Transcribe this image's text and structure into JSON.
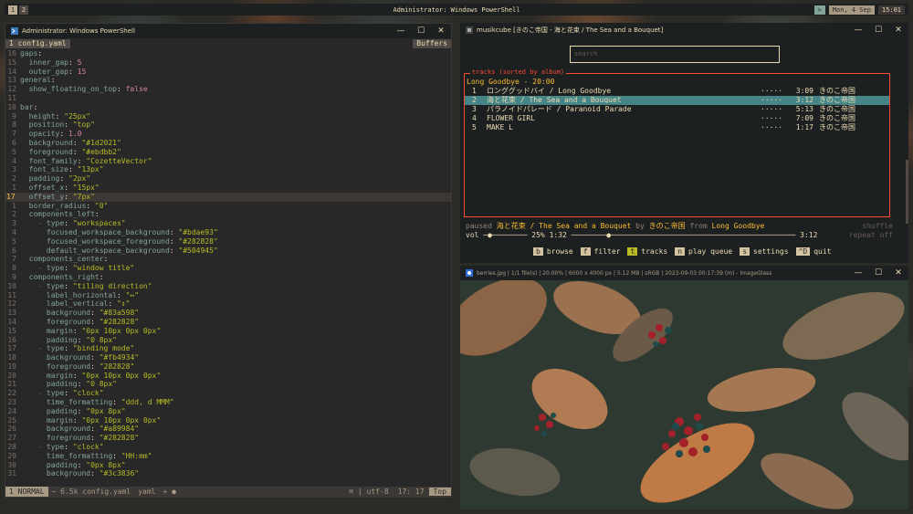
{
  "topbar": {
    "workspaces": [
      "1",
      "2"
    ],
    "window_title": "Administrator: Windows PowerShell",
    "tiling_direction": ">",
    "date": "Mon, 4 Sep",
    "time": "15:01"
  },
  "powershell": {
    "title": "Administrator: Windows PowerShell",
    "tab_file": "1 config.yaml",
    "tab_buffers": "Buffers",
    "lines": [
      {
        "n": "16",
        "t": "gaps:"
      },
      {
        "n": "15",
        "t": "  inner_gap: 5"
      },
      {
        "n": "14",
        "t": "  outer_gap: 15"
      },
      {
        "n": "13",
        "t": "general:"
      },
      {
        "n": "12",
        "t": "  show_floating_on_top: false"
      },
      {
        "n": "11",
        "t": ""
      },
      {
        "n": "10",
        "t": "bar:"
      },
      {
        "n": "9",
        "t": "  height: \"25px\""
      },
      {
        "n": "8",
        "t": "  position: \"top\""
      },
      {
        "n": "7",
        "t": "  opacity: 1.0"
      },
      {
        "n": "6",
        "t": "  background: \"#1d2021\""
      },
      {
        "n": "5",
        "t": "  foreground: \"#ebdbb2\""
      },
      {
        "n": "4",
        "t": "  font_family: \"CozetteVector\""
      },
      {
        "n": "3",
        "t": "  font_size: \"13px\""
      },
      {
        "n": "2",
        "t": "  padding: \"2px\""
      },
      {
        "n": "1",
        "t": "  offset_x: \"15px\""
      },
      {
        "n": "17",
        "t": "  offset_y: \"7px\""
      },
      {
        "n": "1",
        "t": "  border_radius: \"0\""
      },
      {
        "n": "2",
        "t": "  components_left:"
      },
      {
        "n": "3",
        "t": "    - type: \"workspaces\""
      },
      {
        "n": "4",
        "t": "      focused_workspace_background: \"#bdae93\""
      },
      {
        "n": "5",
        "t": "      focused_workspace_foreground: \"#282828\""
      },
      {
        "n": "6",
        "t": "      default_workspace_background: \"#504945\""
      },
      {
        "n": "7",
        "t": "  components_center:"
      },
      {
        "n": "8",
        "t": "    - type: \"window title\""
      },
      {
        "n": "9",
        "t": "  components_right:"
      },
      {
        "n": "10",
        "t": "    - type: \"tiling direction\""
      },
      {
        "n": "11",
        "t": "      label_horizontal: \"↔\""
      },
      {
        "n": "12",
        "t": "      label_vertical: \"↕\""
      },
      {
        "n": "13",
        "t": "      background: \"#83a598\""
      },
      {
        "n": "14",
        "t": "      foreground: \"#282828\""
      },
      {
        "n": "15",
        "t": "      margin: \"0px 10px 0px 0px\""
      },
      {
        "n": "16",
        "t": "      padding: \"0 8px\""
      },
      {
        "n": "17",
        "t": "    - type: \"binding mode\""
      },
      {
        "n": "18",
        "t": "      background: \"#fb4934\""
      },
      {
        "n": "19",
        "t": "      foreground: \"282828\""
      },
      {
        "n": "20",
        "t": "      margin: \"0px 10px 0px 0px\""
      },
      {
        "n": "21",
        "t": "      padding: \"0 8px\""
      },
      {
        "n": "22",
        "t": "    - type: \"clock\""
      },
      {
        "n": "23",
        "t": "      time_formatting: \"ddd, d MMM\""
      },
      {
        "n": "24",
        "t": "      padding: \"0px 8px\""
      },
      {
        "n": "25",
        "t": "      margin: \"0px 10px 0px 0px\""
      },
      {
        "n": "26",
        "t": "      background: \"#a89984\""
      },
      {
        "n": "27",
        "t": "      foreground: \"#282828\""
      },
      {
        "n": "28",
        "t": "    - type: \"clock\""
      },
      {
        "n": "29",
        "t": "      time_formatting: \"HH:mm\""
      },
      {
        "n": "30",
        "t": "      padding: \"0px 8px\""
      },
      {
        "n": "31",
        "t": "      background: \"#3c3836\""
      }
    ],
    "status": {
      "mode": "1 NORMAL",
      "file": "~ 6.5k config.yaml",
      "filetype": "yaml",
      "flags": "+ ●",
      "format": "⌘ | utf-8",
      "position": "17: 17",
      "scroll": "Top"
    }
  },
  "musikcube": {
    "title": "musikcube [きのこ帝国 - 海と花束 / The Sea and a Bouquet]",
    "search_placeholder": "search",
    "tracks_label": "tracks (sorted by album)",
    "album_header": "Long Goodbye - 20:00",
    "tracks": [
      {
        "num": "1",
        "title": "ロンググッドバイ / Long Goodbye",
        "dots": "·····",
        "dur": "3:09",
        "artist": "きのこ帝国"
      },
      {
        "num": "2",
        "title": "海と花束 / The Sea and a Bouquet",
        "dots": "·····",
        "dur": "3:12",
        "artist": "きのこ帝国"
      },
      {
        "num": "3",
        "title": "パラノイドパレード / Paranoid Parade",
        "dots": "·····",
        "dur": "5:13",
        "artist": "きのこ帝国"
      },
      {
        "num": "4",
        "title": "FLOWER GIRL",
        "dots": "·····",
        "dur": "7:09",
        "artist": "きのこ帝国"
      },
      {
        "num": "5",
        "title": "MAKE L",
        "dots": "·····",
        "dur": "1:17",
        "artist": "きのこ帝国"
      }
    ],
    "selected_index": 1,
    "now_playing": {
      "paused": "paused",
      "title": "海と花束 / The Sea and a Bouquet",
      "by": "by",
      "artist": "きのこ帝国",
      "from": "from",
      "album": "Long Goodbye",
      "shuffle": "shuffle"
    },
    "volume": {
      "label": "vol",
      "bar": "─●────────",
      "percent": "25%",
      "elapsed": "1:32",
      "progress_bar": "────────●──────────────────────────────────────────",
      "total": "3:12",
      "repeat": "repeat off"
    },
    "menu": [
      {
        "key": "b",
        "label": "browse",
        "active": false
      },
      {
        "key": "f",
        "label": "filter",
        "active": false
      },
      {
        "key": "t",
        "label": "tracks",
        "active": true
      },
      {
        "key": "n",
        "label": "play queue",
        "active": false
      },
      {
        "key": "s",
        "label": "settings",
        "active": false
      },
      {
        "key": "^D",
        "label": "quit",
        "active": false
      }
    ]
  },
  "imageglass": {
    "title": "berries.jpg  |  1/1 file(s)  |  20.00%  |  6000 x 4000 px  |  5.12 MB  |  sRGB  |  2023-09-03 00:17:39 (m)  - ImageGlass"
  },
  "colors": {
    "bg": "#1d2021",
    "fg": "#ebdbb2",
    "accent_red": "#fb4934",
    "accent_yellow": "#fabd2f",
    "selection": "#458588"
  }
}
